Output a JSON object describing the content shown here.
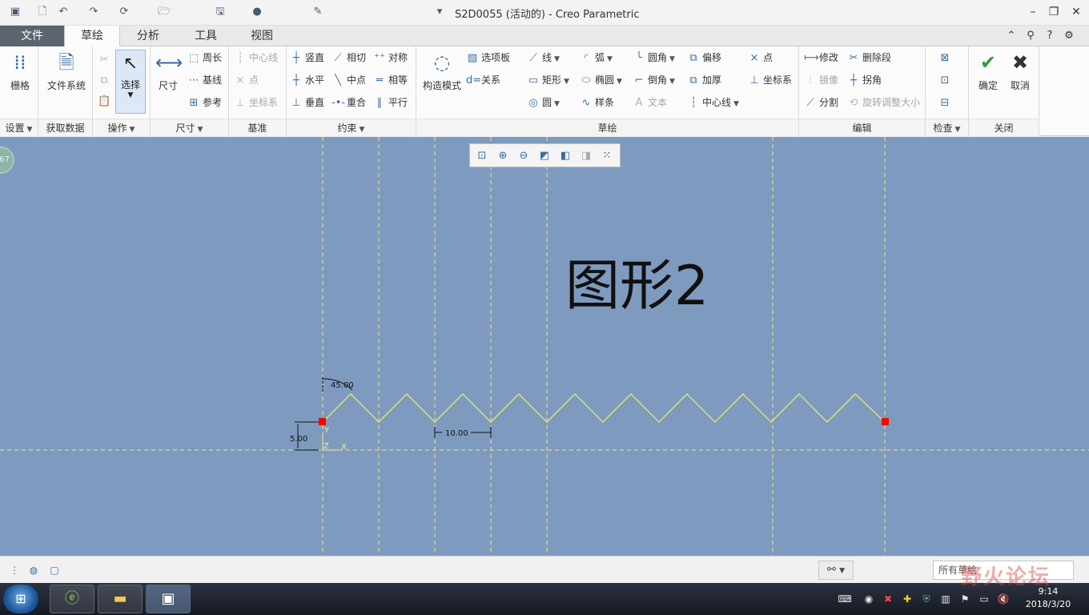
{
  "titlebar": {
    "title": "S2D0055 (活动的) - Creo Parametric",
    "quick_access": [
      "app-icon",
      "new-icon",
      "undo-icon",
      "redo-icon",
      "regenerate-icon",
      "open-icon",
      "save-icon"
    ],
    "window_controls": [
      "minimize",
      "restore",
      "close"
    ]
  },
  "tabs": {
    "file": "文件",
    "items": [
      "草绘",
      "分析",
      "工具",
      "视图"
    ]
  },
  "ribbon": {
    "settings": {
      "grid": "栅格",
      "group": "设置"
    },
    "getdata": {
      "filesystem": "文件系统",
      "group": "获取数据"
    },
    "operations": {
      "select": "选择",
      "group": "操作"
    },
    "dimension": {
      "dim": "尺寸",
      "perimeter": "周长",
      "baseline": "基线",
      "reference": "参考",
      "group": "尺寸"
    },
    "datum": {
      "centerline": "中心线",
      "point": "点",
      "csys": "坐标系",
      "group": "基准"
    },
    "constraint": {
      "vertical": "竖直",
      "tangent": "相切",
      "symmetric": "对称",
      "horizontal": "水平",
      "midpoint": "中点",
      "equal": "相等",
      "perpendicular": "垂直",
      "coincident": "重合",
      "parallel": "平行",
      "group": "约束"
    },
    "sketch": {
      "construction": "构造模式",
      "palette": "选项板",
      "relation": "关系",
      "line": "线",
      "arc": "弧",
      "fillet": "圆角",
      "offset": "偏移",
      "point": "点",
      "rectangle": "矩形",
      "ellipse": "椭圆",
      "chamfer": "倒角",
      "thicken": "加厚",
      "csys": "坐标系",
      "circle": "圆",
      "spline": "样条",
      "text": "文本",
      "centerline": "中心线",
      "group": "草绘"
    },
    "edit": {
      "modify": "修改",
      "delete_segment": "删除段",
      "mirror": "镜像",
      "corner": "拐角",
      "divide": "分割",
      "rotate_resize": "旋转调整大小",
      "group": "编辑"
    },
    "inspect": {
      "group": "检查"
    },
    "close": {
      "ok": "确定",
      "cancel": "取消",
      "group": "关闭"
    }
  },
  "canvas": {
    "title": "图形2",
    "badge": "67",
    "dimensions": {
      "angle": "45.00",
      "height": "5.00",
      "pitch": "10.00"
    },
    "axes": {
      "y": "Y",
      "z": "Z",
      "x": "X"
    }
  },
  "statusbar": {
    "filter": "所有草绘"
  },
  "taskbar": {
    "time": "9:14",
    "date": "2018/3/20"
  },
  "watermark": "野火论坛",
  "colors": {
    "canvas": "#7e9bbf",
    "sketch_line": "#f0f060",
    "point": "#ff0000",
    "accent": "#3a6ea5"
  }
}
